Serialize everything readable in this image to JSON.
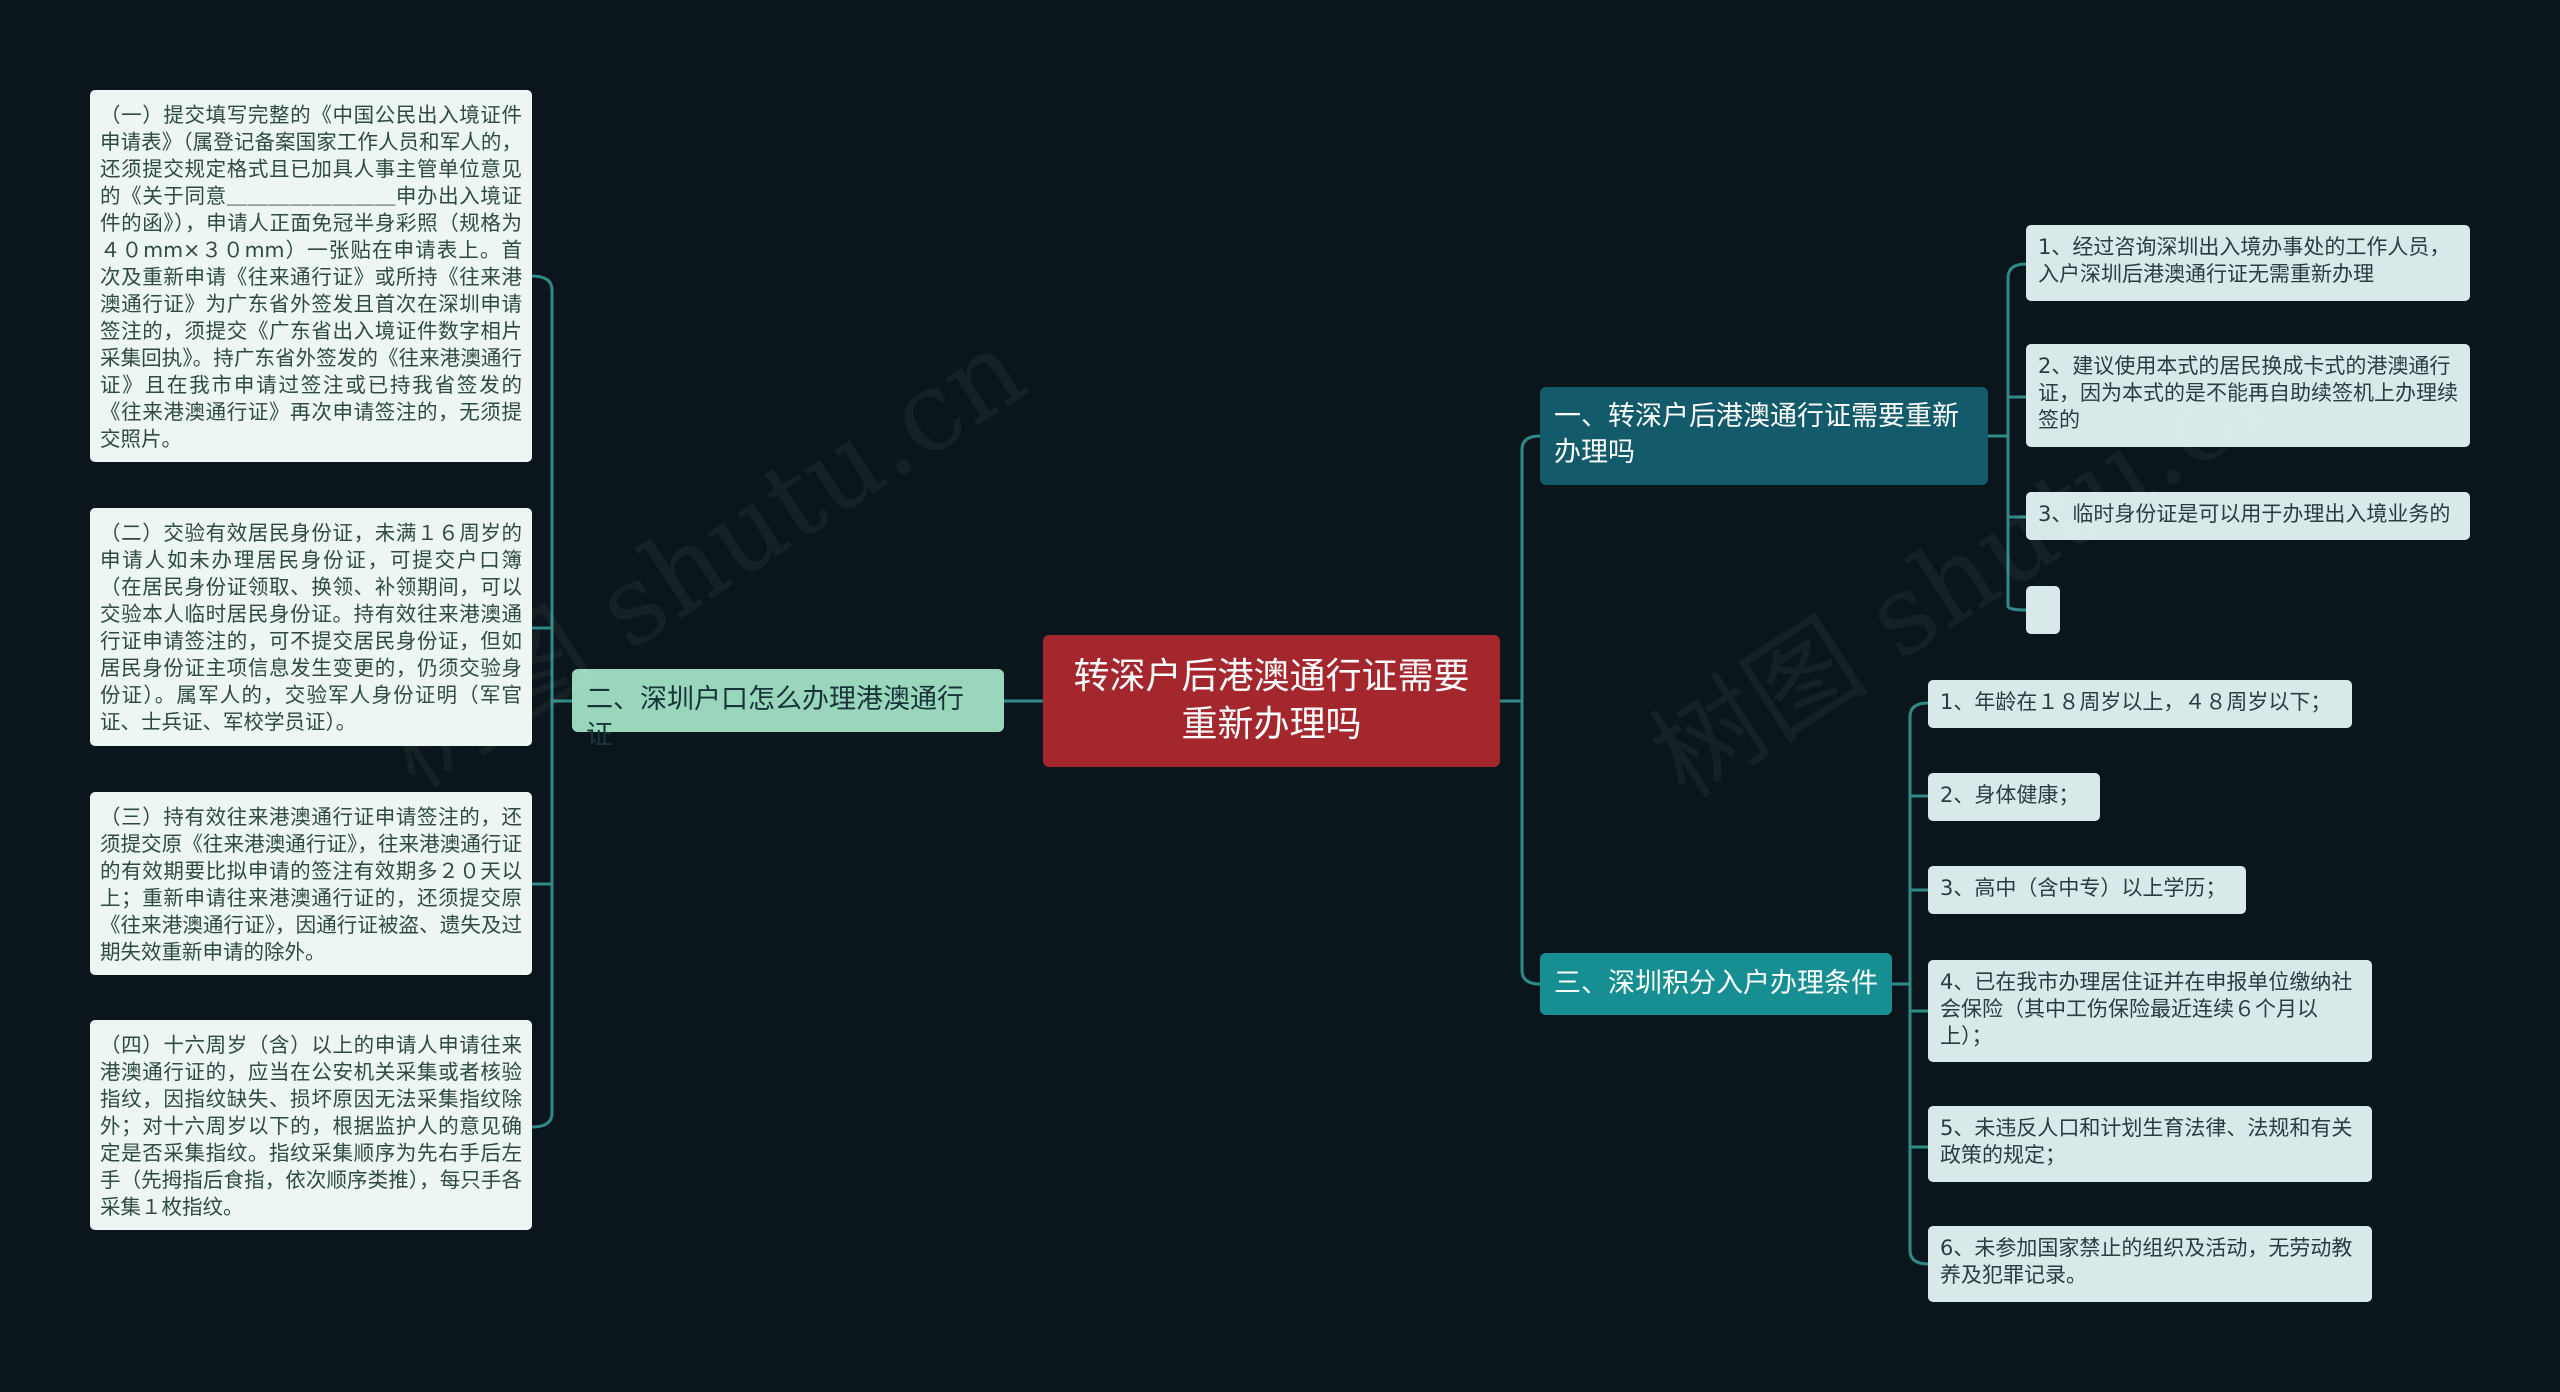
{
  "root": {
    "title": "转深户后港澳通行证需要重新办理吗"
  },
  "branches": {
    "b1": {
      "title": "一、转深户后港澳通行证需要重新办理吗",
      "items": [
        "1、经过咨询深圳出入境办事处的工作人员，入户深圳后港澳通行证无需重新办理",
        "2、建议使用本式的居民换成卡式的港澳通行证，因为本式的是不能再自助续签机上办理续签的",
        "3、临时身份证是可以用于办理出入境业务的",
        ""
      ]
    },
    "b2": {
      "title": "二、深圳户口怎么办理港澳通行证",
      "items": [
        "（一）提交填写完整的《中国公民出入境证件申请表》（属登记备案国家工作人员和军人的，还须提交规定格式且已加具人事主管单位意见的《关于同意＿＿＿＿＿＿＿＿申办出入境证件的函》），申请人正面免冠半身彩照（规格为４０mm×３０mm）一张贴在申请表上。首次及重新申请《往来通行证》或所持《往来港澳通行证》为广东省外签发且首次在深圳申请签注的，须提交《广东省出入境证件数字相片采集回执》。持广东省外签发的《往来港澳通行证》且在我市申请过签注或已持我省签发的《往来港澳通行证》再次申请签注的，无须提交照片。",
        "（二）交验有效居民身份证，未满１６周岁的申请人如未办理居民身份证，可提交户口簿（在居民身份证领取、换领、补领期间，可以交验本人临时居民身份证。持有效往来港澳通行证申请签注的，可不提交居民身份证，但如居民身份证主项信息发生变更的，仍须交验身份证）。属军人的，交验军人身份证明（军官证、士兵证、军校学员证）。",
        "（三）持有效往来港澳通行证申请签注的，还须提交原《往来港澳通行证》，往来港澳通行证的有效期要比拟申请的签注有效期多２０天以上；重新申请往来港澳通行证的，还须提交原《往来港澳通行证》，因通行证被盗、遗失及过期失效重新申请的除外。",
        "（四）十六周岁（含）以上的申请人申请往来港澳通行证的，应当在公安机关采集或者核验指纹，因指纹缺失、损坏原因无法采集指纹除外；对十六周岁以下的，根据监护人的意见确定是否采集指纹。指纹采集顺序为先右手后左手（先拇指后食指，依次顺序类推），每只手各采集１枚指纹。"
      ]
    },
    "b3": {
      "title": "三、深圳积分入户办理条件",
      "items": [
        "1、年龄在１８周岁以上，４８周岁以下；",
        "2、身体健康；",
        "3、高中（含中专）以上学历；",
        "4、已在我市办理居住证并在申报单位缴纳社会保险（其中工伤保险最近连续６个月以上）；",
        "5、未违反人口和计划生育法律、法规和有关政策的规定；",
        "6、未参加国家禁止的组织及活动，无劳动教养及犯罪记录。"
      ]
    }
  },
  "watermark": "树图 shutu.cn",
  "colors": {
    "background": "#0a161b",
    "root": "#a3272c",
    "branch1": "#135a6a",
    "branch2": "#9ad6bb",
    "branch3": "#178f92",
    "link": "#2f8a87"
  }
}
